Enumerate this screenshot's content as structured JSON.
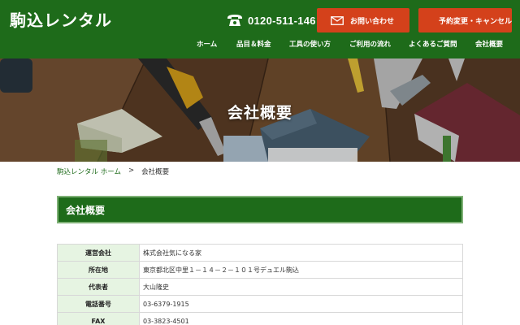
{
  "header": {
    "logo": "駒込レンタル",
    "phone": "0120-511-146",
    "contact_button": "お問い合わせ",
    "reserve_button": "予約変更・キャンセル"
  },
  "nav": {
    "items": [
      {
        "label": "ホーム"
      },
      {
        "label": "品目＆料金"
      },
      {
        "label": "工具の使い方"
      },
      {
        "label": "ご利用の流れ"
      },
      {
        "label": "よくあるご質問"
      },
      {
        "label": "会社概要"
      }
    ]
  },
  "hero": {
    "title": "会社概要"
  },
  "breadcrumb": {
    "home": "駒込レンタル ホーム",
    "separator": ">",
    "current": "会社概要"
  },
  "section": {
    "heading": "会社概要"
  },
  "company_table": {
    "rows": [
      {
        "label": "運営会社",
        "value": "株式会社気になる家"
      },
      {
        "label": "所在地",
        "value": "東京都北区中里１－１４－２－１０１号デュエル駒込"
      },
      {
        "label": "代表者",
        "value": "大山隆史"
      },
      {
        "label": "電話番号",
        "value": "03-6379-1915"
      },
      {
        "label": "FAX",
        "value": "03-3823-4501"
      }
    ]
  },
  "colors": {
    "brand_green": "#1e6b1a",
    "accent_orange": "#d4411b",
    "table_header_bg": "#e6f4e2"
  },
  "icons": {
    "phone": "phone-icon",
    "mail": "mail-icon"
  }
}
